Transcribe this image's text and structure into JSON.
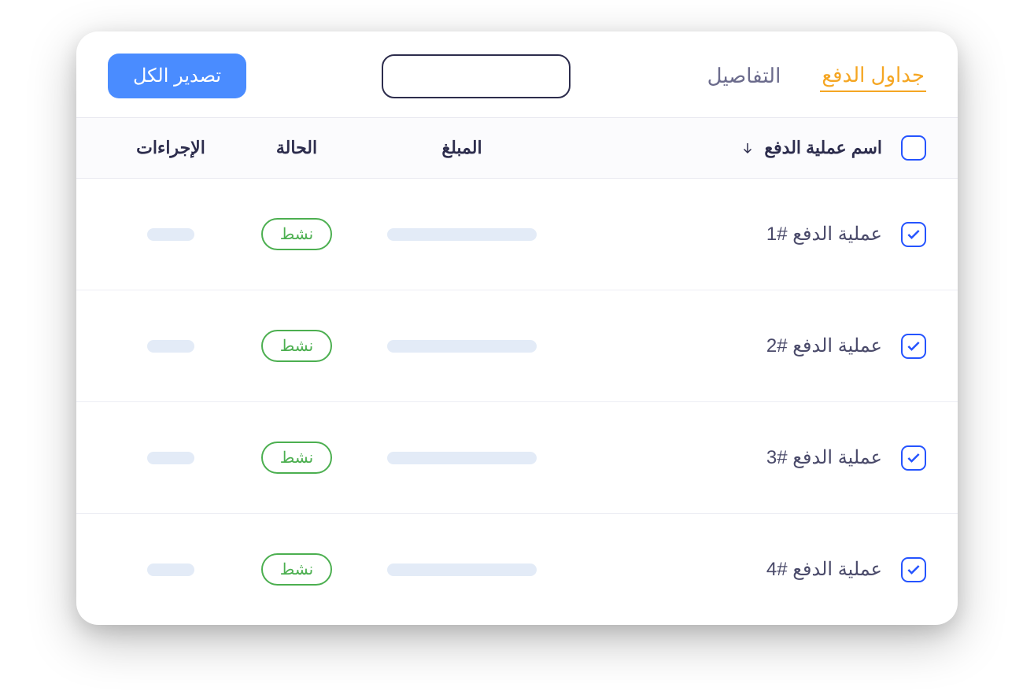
{
  "header": {
    "tabs": [
      {
        "label": "جداول الدفع",
        "active": true
      },
      {
        "label": "التفاصيل",
        "active": false
      }
    ],
    "search_placeholder": "",
    "export_label": "تصدير الكل"
  },
  "table": {
    "columns": {
      "name": "اسم عملية الدفع",
      "amount": "المبلغ",
      "status": "الحالة",
      "actions": "الإجراءات"
    },
    "select_all_checked": false,
    "rows": [
      {
        "checked": true,
        "name": "عملية الدفع #1",
        "status": "نشط"
      },
      {
        "checked": true,
        "name": "عملية الدفع #2",
        "status": "نشط"
      },
      {
        "checked": true,
        "name": "عملية الدفع #3",
        "status": "نشط"
      },
      {
        "checked": true,
        "name": "عملية الدفع #4",
        "status": "نشط"
      }
    ]
  }
}
